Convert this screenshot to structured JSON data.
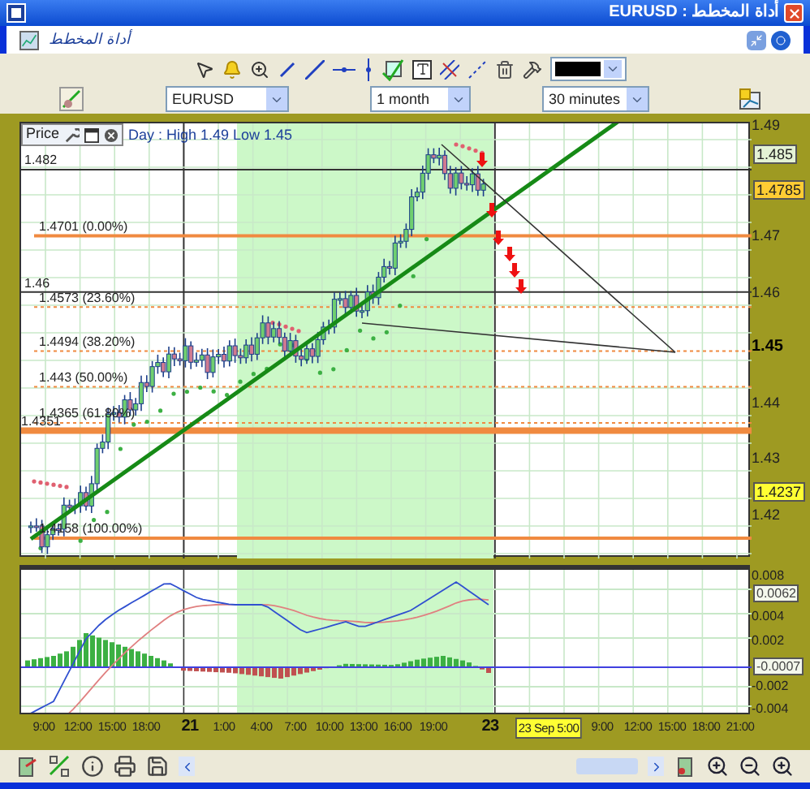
{
  "window": {
    "title": "أداة المخطط : EURUSD"
  },
  "header": {
    "title": "أداة المخطط"
  },
  "selectors": [
    {
      "value": "EURUSD"
    },
    {
      "value": "1 month"
    },
    {
      "value": "30 minutes"
    }
  ],
  "price_panel": {
    "legend_title": "Price",
    "info": "Day : High 1.49 Low 1.45",
    "level_labels": [
      "1.482",
      "1.4701 (0.00%)",
      "1.46",
      "1.4573 (23.60%)",
      "1.4494 (38.20%)",
      "1.443 (50.00%)",
      "1.4365 (61.80%)",
      "1.4351",
      "1.4158 (100.00%)"
    ],
    "axis_labels": [
      {
        "text": "1.49",
        "kind": "tick"
      },
      {
        "text": "1.47",
        "kind": "tick"
      },
      {
        "text": "1.46",
        "kind": "tick"
      },
      {
        "text": "1.45",
        "kind": "major"
      },
      {
        "text": "1.44",
        "kind": "tick"
      },
      {
        "text": "1.43",
        "kind": "tick"
      },
      {
        "text": "1.42",
        "kind": "tick"
      }
    ],
    "price_tags": [
      {
        "text": "1.485",
        "color": "#e4f2d4"
      },
      {
        "text": "1.4785",
        "color": "#ffcc33"
      },
      {
        "text": "1.4237",
        "color": "#ffff33"
      }
    ]
  },
  "indicator_panel": {
    "axis_labels": [
      "0.008",
      "0.004",
      "0.002",
      "-0.002",
      "-0.004"
    ],
    "tags": [
      "0.0062",
      "-0.0007"
    ]
  },
  "time_axis": [
    {
      "text": "9:00",
      "kind": "time"
    },
    {
      "text": "12:00",
      "kind": "time"
    },
    {
      "text": "15:00",
      "kind": "time"
    },
    {
      "text": "18:00",
      "kind": "time"
    },
    {
      "text": "21",
      "kind": "day"
    },
    {
      "text": "1:00",
      "kind": "time"
    },
    {
      "text": "4:00",
      "kind": "time"
    },
    {
      "text": "7:00",
      "kind": "time"
    },
    {
      "text": "10:00",
      "kind": "time"
    },
    {
      "text": "13:00",
      "kind": "time"
    },
    {
      "text": "16:00",
      "kind": "time"
    },
    {
      "text": "19:00",
      "kind": "time"
    },
    {
      "text": "23",
      "kind": "day"
    },
    {
      "text": "23 Sep 5:00",
      "kind": "cursor"
    },
    {
      "text": "9:00",
      "kind": "time"
    },
    {
      "text": "12:00",
      "kind": "time"
    },
    {
      "text": "15:00",
      "kind": "time"
    },
    {
      "text": "18:00",
      "kind": "time"
    },
    {
      "text": "21:00",
      "kind": "time"
    }
  ]
}
